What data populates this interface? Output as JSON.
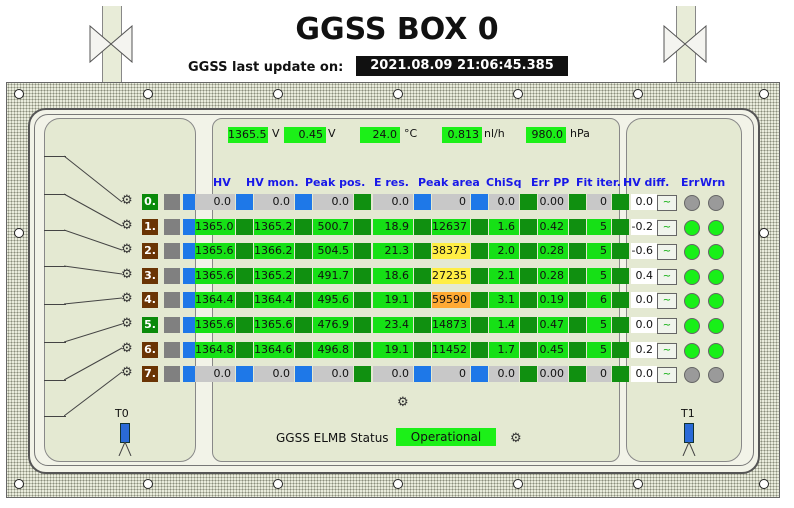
{
  "title": "GGSS BOX 0",
  "update": {
    "label": "GGSS last update on:",
    "value": "2021.08.09 21:06:45.385"
  },
  "gauges": [
    {
      "value": "1365.5",
      "unit": "V"
    },
    {
      "value": "0.45",
      "unit": "V"
    },
    {
      "value": "24.0",
      "unit": "°C"
    },
    {
      "value": "0.813",
      "unit": "nl/h"
    },
    {
      "value": "980.0",
      "unit": "hPa"
    }
  ],
  "headers": {
    "hv": "HV",
    "hvmon": "HV mon.",
    "peakpos": "Peak pos.",
    "eres": "E res.",
    "peakarea": "Peak area",
    "chisq": "ChiSq",
    "errpp": "Err PP",
    "fititer": "Fit iter.",
    "hvdiff": "HV diff.",
    "err": "Err",
    "wrn": "Wrn"
  },
  "colors": {
    "ok": "#16e016",
    "warn_yellow": "#ffee44",
    "warn_orange": "#ffaa33",
    "inactive": "#c8c8c8",
    "ch_active": "#0a8a0a",
    "ch_special": "#6a3404"
  },
  "channels": [
    {
      "ch": "0.",
      "hv": "0.0",
      "hvmon": "0.0",
      "peakpos": "0.0",
      "eres": "0.0",
      "peakarea": "0",
      "chisq": "0.0",
      "errpp": "0.00",
      "fititer": "0",
      "hvdiff": "0.0",
      "active": false,
      "leds": "off"
    },
    {
      "ch": "1.",
      "hv": "1365.0",
      "hvmon": "1365.2",
      "peakpos": "500.7",
      "eres": "18.9",
      "peakarea": "12637",
      "chisq": "1.6",
      "errpp": "0.42",
      "fititer": "5",
      "hvdiff": "-0.2",
      "active": true,
      "leds": "on",
      "area_state": "ok"
    },
    {
      "ch": "2.",
      "hv": "1365.6",
      "hvmon": "1366.2",
      "peakpos": "504.5",
      "eres": "21.3",
      "peakarea": "38373",
      "chisq": "2.0",
      "errpp": "0.28",
      "fititer": "5",
      "hvdiff": "-0.6",
      "active": true,
      "leds": "on",
      "area_state": "yellow"
    },
    {
      "ch": "3.",
      "hv": "1365.6",
      "hvmon": "1365.2",
      "peakpos": "491.7",
      "eres": "18.6",
      "peakarea": "27235",
      "chisq": "2.1",
      "errpp": "0.28",
      "fititer": "5",
      "hvdiff": "0.4",
      "active": true,
      "leds": "on",
      "area_state": "yellow"
    },
    {
      "ch": "4.",
      "hv": "1364.4",
      "hvmon": "1364.4",
      "peakpos": "495.6",
      "eres": "19.1",
      "peakarea": "59590",
      "chisq": "3.1",
      "errpp": "0.19",
      "fititer": "6",
      "hvdiff": "0.0",
      "active": true,
      "leds": "on",
      "area_state": "orange"
    },
    {
      "ch": "5.",
      "hv": "1365.6",
      "hvmon": "1365.6",
      "peakpos": "476.9",
      "eres": "23.4",
      "peakarea": "14873",
      "chisq": "1.4",
      "errpp": "0.47",
      "fititer": "5",
      "hvdiff": "0.0",
      "active": true,
      "leds": "on",
      "area_state": "ok"
    },
    {
      "ch": "6.",
      "hv": "1364.8",
      "hvmon": "1364.6",
      "peakpos": "496.8",
      "eres": "19.1",
      "peakarea": "11452",
      "chisq": "1.7",
      "errpp": "0.45",
      "fititer": "5",
      "hvdiff": "0.2",
      "active": true,
      "leds": "on",
      "area_state": "ok"
    },
    {
      "ch": "7.",
      "hv": "0.0",
      "hvmon": "0.0",
      "peakpos": "0.0",
      "eres": "0.0",
      "peakarea": "0",
      "chisq": "0.0",
      "errpp": "0.00",
      "fititer": "0",
      "hvdiff": "0.0",
      "active": false,
      "leds": "off"
    }
  ],
  "status": {
    "label": "GGSS ELMB Status",
    "value": "Operational"
  },
  "sensors": {
    "t0": "T0",
    "t1": "T1"
  }
}
